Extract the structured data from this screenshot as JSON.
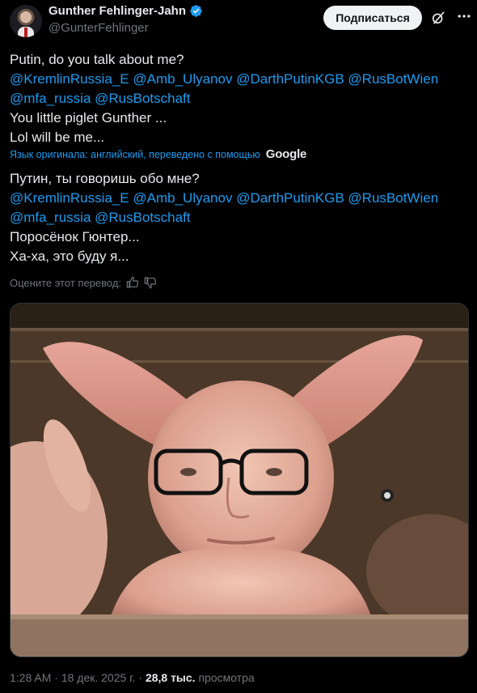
{
  "header": {
    "display_name": "Gunther Fehlinger-Jahn",
    "handle": "@GunterFehlinger",
    "subscribe_label": "Подписаться"
  },
  "tweet": {
    "original_lines": [
      [
        {
          "t": "Putin, do you talk about me?",
          "m": false
        }
      ],
      [
        {
          "t": "@KremlinRussia_E",
          "m": true
        },
        {
          "t": " ",
          "m": false
        },
        {
          "t": "@Amb_Ulyanov",
          "m": true
        },
        {
          "t": " ",
          "m": false
        },
        {
          "t": "@DarthPutinKGB",
          "m": true
        },
        {
          "t": " ",
          "m": false
        },
        {
          "t": "@RusBotWien",
          "m": true
        }
      ],
      [
        {
          "t": "@mfa_russia",
          "m": true
        },
        {
          "t": " ",
          "m": false
        },
        {
          "t": "@RusBotschaft",
          "m": true
        }
      ],
      [
        {
          "t": "You little piglet Gunther ...",
          "m": false
        }
      ],
      [
        {
          "t": "Lol will be me...",
          "m": false
        }
      ]
    ],
    "translation_note": "Язык оригинала: английский, переведено с помощью",
    "translation_provider": "Google",
    "translated_lines": [
      [
        {
          "t": "Путин, ты говоришь обо мне?",
          "m": false
        }
      ],
      [
        {
          "t": "@KremlinRussia_E",
          "m": true
        },
        {
          "t": " ",
          "m": false
        },
        {
          "t": "@Amb_Ulyanov",
          "m": true
        },
        {
          "t": " ",
          "m": false
        },
        {
          "t": "@DarthPutinKGB",
          "m": true
        },
        {
          "t": " ",
          "m": false
        },
        {
          "t": "@RusBotWien",
          "m": true
        }
      ],
      [
        {
          "t": "@mfa_russia",
          "m": true
        },
        {
          "t": " ",
          "m": false
        },
        {
          "t": "@RusBotschaft",
          "m": true
        }
      ],
      [
        {
          "t": "Поросёнок Гюнтер...",
          "m": false
        }
      ],
      [
        {
          "t": "Ха-ха, это буду я...",
          "m": false
        }
      ]
    ],
    "rate_label": "Оцените этот перевод:"
  },
  "footer": {
    "time": "1:28 AM",
    "date": "18 дек. 2025 г.",
    "views_count": "28,8 тыс.",
    "views_label": "просмотра"
  },
  "colors": {
    "background": "#000000",
    "text": "#e7e9ea",
    "secondary": "#71767b",
    "accent": "#1d9bf0"
  },
  "icons": [
    "verified-badge-icon",
    "grok-icon",
    "more-icon",
    "thumbs-up-icon",
    "thumbs-down-icon"
  ]
}
